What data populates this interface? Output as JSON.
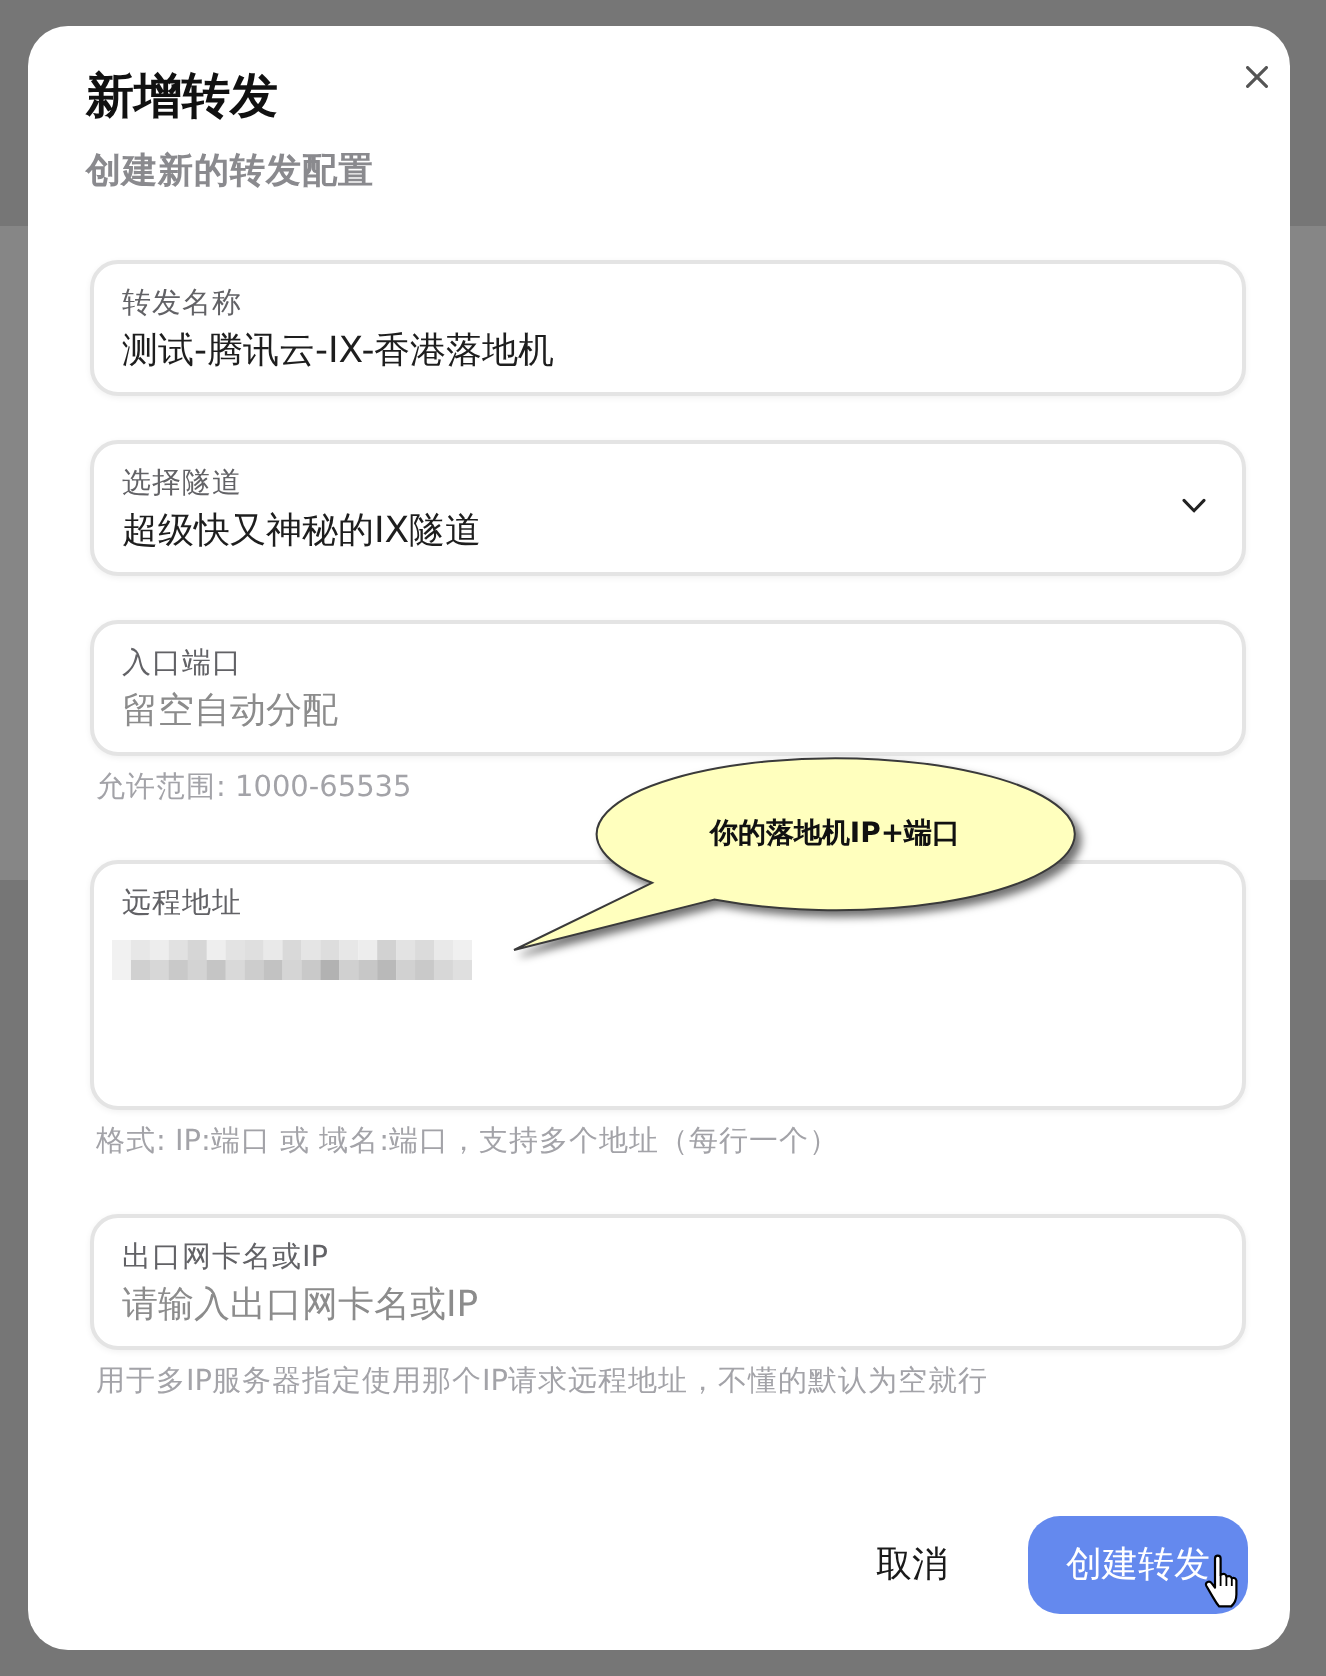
{
  "dialog": {
    "title": "新增转发",
    "subtitle": "创建新的转发配置",
    "fields": [
      {
        "kind": "text",
        "label": "转发名称",
        "value": "测试-腾讯云-IX-香港落地机"
      },
      {
        "kind": "select",
        "label": "选择隧道",
        "value": "超级快又神秘的IX隧道"
      },
      {
        "kind": "text",
        "label": "入口端口",
        "placeholder": "留空自动分配",
        "hint": "允许范围: 1000-65535"
      },
      {
        "kind": "textarea",
        "label": "远程地址",
        "redacted": true,
        "hint": "格式: IP:端口 或 域名:端口，支持多个地址（每行一个）"
      },
      {
        "kind": "text",
        "label": "出口网卡名或IP",
        "placeholder": "请输入出口网卡名或IP",
        "hint": "用于多IP服务器指定使用那个IP请求远程地址，不懂的默认为空就行"
      }
    ],
    "buttons": [
      {
        "kind": "plain",
        "label": "取消",
        "hovered": false
      },
      {
        "kind": "primary",
        "label": "创建转发",
        "hovered": true
      }
    ]
  },
  "annotation": {
    "text": "你的落地机IP+端口"
  }
}
